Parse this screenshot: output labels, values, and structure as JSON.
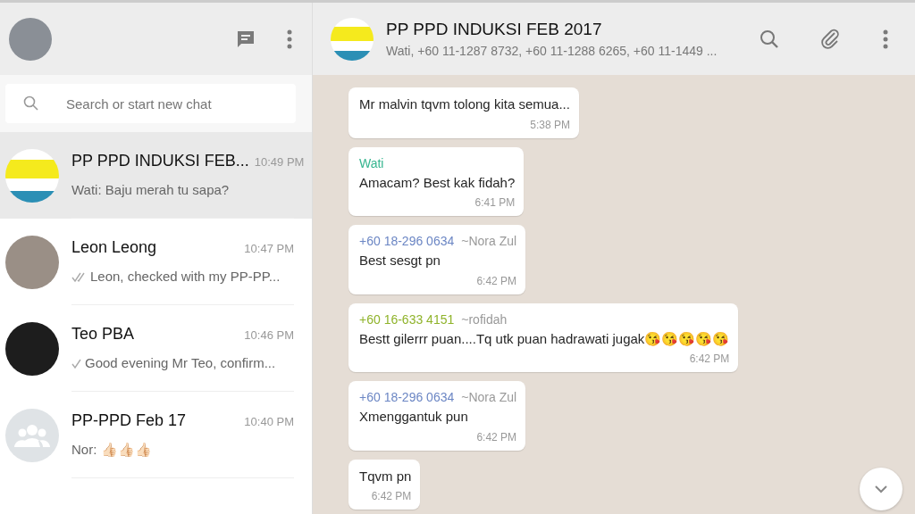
{
  "sidebar": {
    "search": {
      "placeholder": "Search or start new chat"
    },
    "chats": [
      {
        "name": "PP PPD INDUKSI FEB...",
        "time": "10:49 PM",
        "preview": "Wati: Baju merah tu sapa?",
        "selected": true,
        "avatar": {
          "kind": "poster"
        }
      },
      {
        "name": "Leon Leong",
        "time": "10:47 PM",
        "preview": "Leon, checked with my PP-PP...",
        "selected": false,
        "avatar": {
          "kind": "photo"
        },
        "tick": {
          "kind": "double"
        }
      },
      {
        "name": "Teo PBA",
        "time": "10:46 PM",
        "preview": "Good evening Mr Teo, confirm...",
        "selected": false,
        "avatar": {
          "kind": "logo"
        },
        "tick": {
          "kind": "single"
        }
      },
      {
        "name": "PP-PPD Feb 17",
        "time": "10:40 PM",
        "preview": "Nor: 👍🏻👍🏻👍🏻",
        "selected": false,
        "avatar": {
          "kind": "group"
        }
      }
    ]
  },
  "conversation": {
    "title": "PP PPD INDUKSI FEB 2017",
    "members": "Wati, +60 11-1287 8732, +60 11-1288 6265, +60 11-1449 ...",
    "messages": [
      {
        "text": "Mr malvin tqvm tolong kita semua...",
        "time": "5:38 PM"
      },
      {
        "sender": "Wati",
        "color": "#35b58f",
        "text": "Amacam? Best kak fidah?",
        "time": "6:41 PM"
      },
      {
        "sender": "+60 18-296 0634",
        "alias": "~Nora Zul",
        "color": "#6b86c4",
        "text": "Best sesgt pn",
        "time": "6:42 PM"
      },
      {
        "sender": "+60 16-633 4151",
        "alias": "~rofidah",
        "color": "#8fb32a",
        "text": "Bestt gilerrr puan....Tq utk puan hadrawati jugak😘😘😘😘😘",
        "time": "6:42 PM"
      },
      {
        "sender": "+60 18-296 0634",
        "alias": "~Nora Zul",
        "color": "#6b86c4",
        "text": "Xmenggantuk pun",
        "time": "6:42 PM"
      },
      {
        "text": "Tqvm pn",
        "time": "6:42 PM"
      }
    ]
  }
}
